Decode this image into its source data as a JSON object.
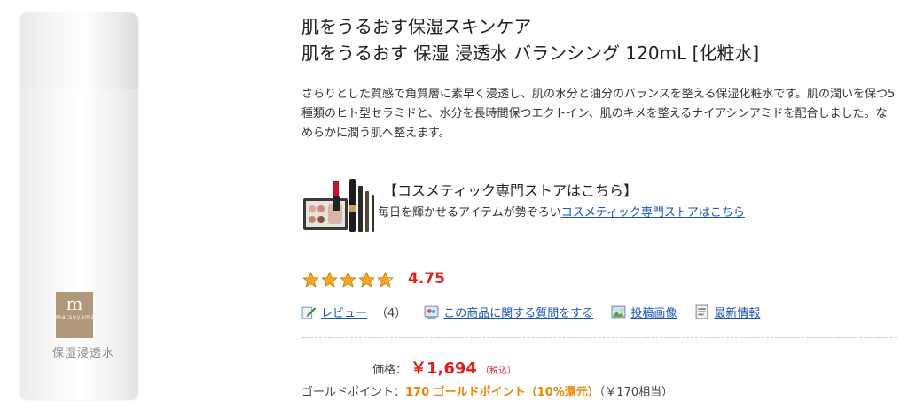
{
  "product": {
    "brand_mark": "m",
    "brand_word": "matsuyama",
    "bottle_label": "保湿浸透水"
  },
  "title": {
    "line1": "肌をうるおす保湿スキンケア",
    "line2": "肌をうるおす 保湿 浸透水 バランシング 120mL [化粧水]"
  },
  "description": "さらりとした質感で角質層に素早く浸透し、肌の水分と油分のバランスを整える保湿化粧水です。肌の潤いを保つ5種類のヒト型セラミドと、水分を長時間保つエクトイン、肌のキメを整えるナイアシンアミドを配合しました。なめらかに潤う肌へ整えます。",
  "promo": {
    "title": "【コスメティック専門ストアはこちら】",
    "sub_text": "毎日を輝かせるアイテムが勢ぞろい",
    "link_text": "コスメティック専門ストアはこちら"
  },
  "rating": {
    "value": "4.75",
    "stars": 4.75,
    "max": 5
  },
  "links": {
    "review_label": "レビュー",
    "review_count": "（4）",
    "question_label": "この商品に関する質問をする",
    "photo_label": "投稿画像",
    "news_label": "最新情報"
  },
  "price": {
    "label": "価格：",
    "value": "￥1,694",
    "tax": "（税込）"
  },
  "gold": {
    "label": "ゴールドポイント：",
    "value": "170 ゴールドポイント（10%還元）",
    "equiv": "（￥170相当）"
  },
  "colors": {
    "price_red": "#e02020",
    "link_blue": "#1a56b7",
    "gold_orange": "#f08300",
    "star_orange": "#f5a623"
  },
  "icons": [
    "review-pencil-icon",
    "question-icon",
    "photo-icon",
    "news-icon"
  ]
}
